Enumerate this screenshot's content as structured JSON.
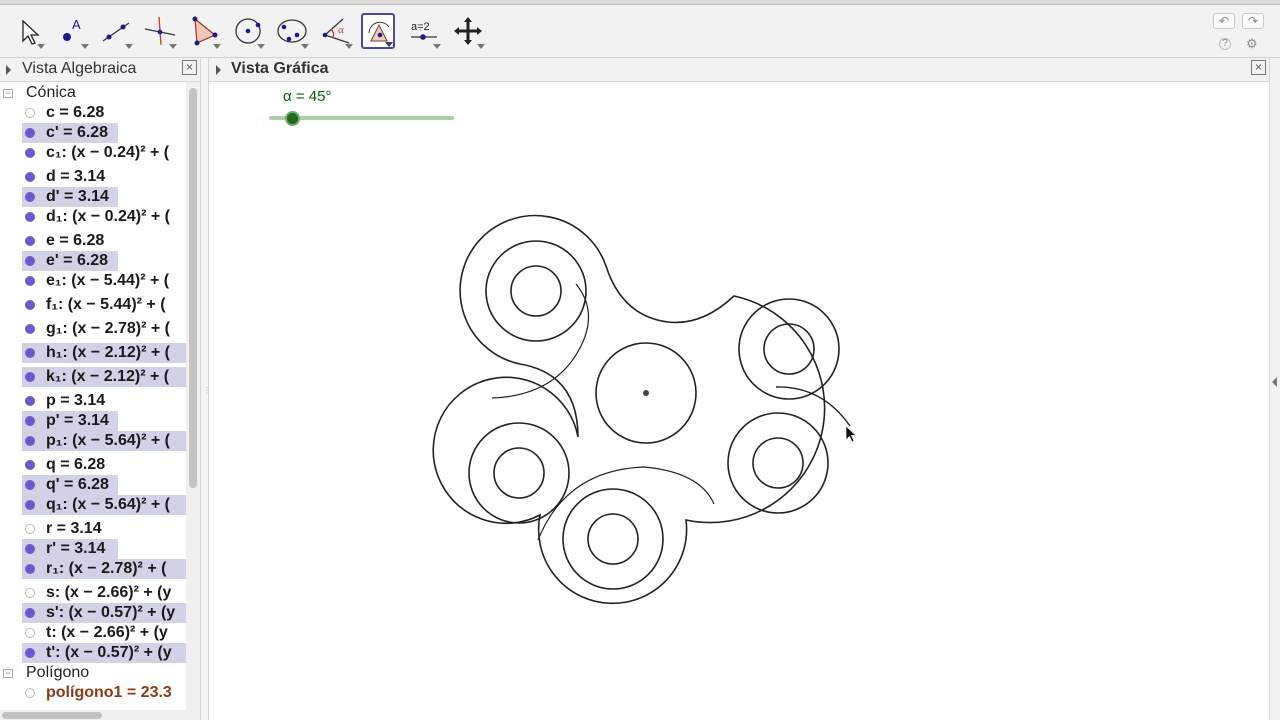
{
  "window": {
    "top_title_fragment": ""
  },
  "toolbar": {
    "tools": [
      {
        "name": "move-tool",
        "icon": "arrow-cursor-icon"
      },
      {
        "name": "point-tool",
        "icon": "point-A-icon",
        "label": "A"
      },
      {
        "name": "line-tool",
        "icon": "line-through-two-points-icon"
      },
      {
        "name": "perpendicular-tool",
        "icon": "perpendicular-line-icon"
      },
      {
        "name": "polygon-tool",
        "icon": "polygon-icon"
      },
      {
        "name": "circle-tool",
        "icon": "circle-center-point-icon"
      },
      {
        "name": "conic-tool",
        "icon": "ellipse-icon"
      },
      {
        "name": "angle-tool",
        "icon": "angle-icon",
        "label": "α"
      },
      {
        "name": "rotate-tool",
        "icon": "rotate-around-point-icon",
        "active": true
      },
      {
        "name": "slider-tool",
        "icon": "slider-icon",
        "label": "a=2"
      },
      {
        "name": "move-view-tool",
        "icon": "move-graphics-view-icon"
      }
    ],
    "undo_icon": "undo-icon",
    "redo_icon": "redo-icon",
    "help_glyph": "?",
    "settings_glyph": "⚙"
  },
  "algebra_view": {
    "title": "Vista Algebraica",
    "close_glyph": "×",
    "groups": [
      {
        "title": "Cónica",
        "items": [
          {
            "text": "c = 6.28",
            "visible": false,
            "selected": false
          },
          {
            "text": "c' = 6.28",
            "visible": true,
            "selected": true
          },
          {
            "text": "c₁: (x − 0.24)² + (",
            "visible": true,
            "selected": false
          },
          {
            "text": "d = 3.14",
            "visible": true,
            "selected": false
          },
          {
            "text": "d' = 3.14",
            "visible": true,
            "selected": true
          },
          {
            "text": "d₁: (x − 0.24)² + (",
            "visible": true,
            "selected": false
          },
          {
            "text": "e = 6.28",
            "visible": true,
            "selected": false
          },
          {
            "text": "e' = 6.28",
            "visible": true,
            "selected": true
          },
          {
            "text": "e₁: (x − 5.44)² + (",
            "visible": true,
            "selected": false
          },
          {
            "text": "f₁: (x − 5.44)² + (",
            "visible": true,
            "selected": false
          },
          {
            "text": "g₁: (x − 2.78)² + (",
            "visible": true,
            "selected": false
          },
          {
            "text": "h₁: (x − 2.12)² + (",
            "visible": true,
            "selected": true
          },
          {
            "text": "k₁: (x − 2.12)² + (",
            "visible": true,
            "selected": true
          },
          {
            "text": "p = 3.14",
            "visible": true,
            "selected": false
          },
          {
            "text": "p' = 3.14",
            "visible": true,
            "selected": true
          },
          {
            "text": "p₁: (x − 5.64)² + (",
            "visible": true,
            "selected": true
          },
          {
            "text": "q = 6.28",
            "visible": true,
            "selected": false
          },
          {
            "text": "q' = 6.28",
            "visible": true,
            "selected": true
          },
          {
            "text": "q₁: (x − 5.64)² + (",
            "visible": true,
            "selected": true
          },
          {
            "text": "r = 3.14",
            "visible": false,
            "selected": false
          },
          {
            "text": "r' = 3.14",
            "visible": true,
            "selected": true
          },
          {
            "text": "r₁: (x − 2.78)² + (",
            "visible": true,
            "selected": true
          },
          {
            "text": "s: (x − 2.66)² + (y",
            "visible": false,
            "selected": false
          },
          {
            "text": "s': (x − 0.57)² + (y",
            "visible": true,
            "selected": true
          },
          {
            "text": "t: (x − 2.66)² + (y",
            "visible": false,
            "selected": false
          },
          {
            "text": "t': (x − 0.57)² + (y",
            "visible": true,
            "selected": true
          }
        ]
      },
      {
        "title": "Polígono",
        "items": [
          {
            "text": "polígono1 = 23.3",
            "visible": false,
            "selected": false,
            "poly": true
          }
        ]
      }
    ]
  },
  "graphics_view": {
    "title": "Vista Gráfica",
    "close_glyph": "×",
    "slider": {
      "label": "α = 45°",
      "value_degrees": 45,
      "min_degrees": 0,
      "max_degrees": 360
    }
  },
  "colors": {
    "selection_highlight": "#d2d2e6",
    "point_fill": "#6a5acd",
    "slider_green": "#006400",
    "polygon_text": "#8b3a1a",
    "active_tool_border": "#4a4a9a"
  }
}
